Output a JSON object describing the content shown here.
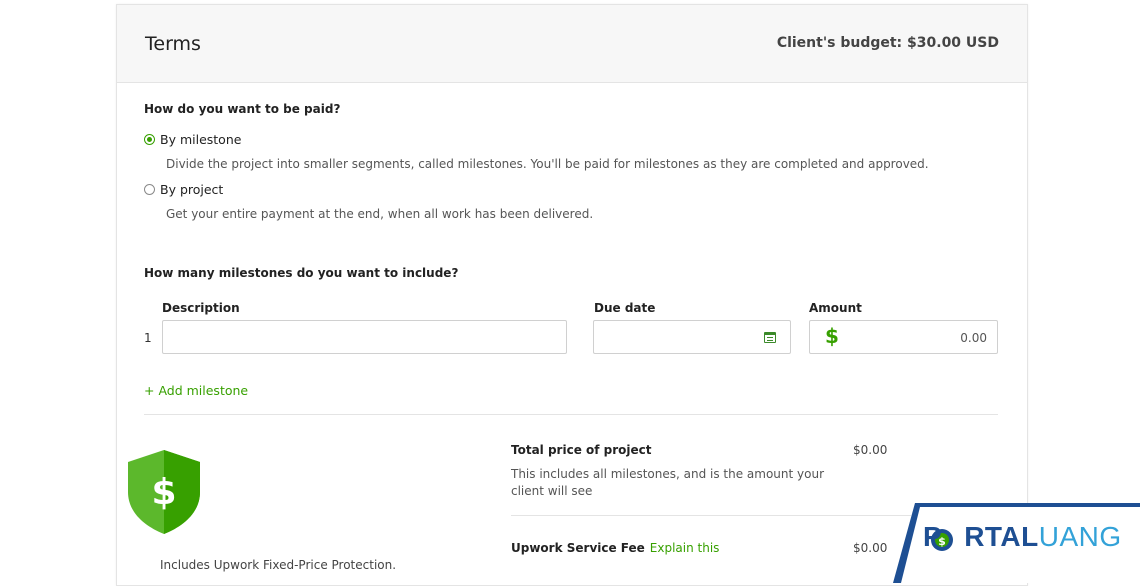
{
  "header": {
    "title": "Terms",
    "budget": "Client's budget: $30.00 USD"
  },
  "payment": {
    "question": "How do you want to be paid?",
    "options": [
      {
        "label": "By milestone",
        "description": "Divide the project into smaller segments, called milestones. You'll be paid for milestones as they are completed and approved.",
        "selected": true
      },
      {
        "label": "By project",
        "description": "Get your entire payment at the end, when all work has been delivered.",
        "selected": false
      }
    ]
  },
  "milestones": {
    "question": "How many milestones do you want to include?",
    "columns": {
      "description": "Description",
      "due_date": "Due date",
      "amount": "Amount"
    },
    "rows": [
      {
        "index": "1",
        "description": "",
        "due_date": "",
        "currency": "$",
        "amount": "0.00"
      }
    ],
    "add_label": "+ Add milestone"
  },
  "summary": {
    "protection_text": "Includes Upwork Fixed-Price Protection.",
    "total_title": "Total price of project",
    "total_value": "$0.00",
    "total_desc": "This includes all milestones, and is the amount your client will see",
    "fee_title": "Upwork Service Fee",
    "fee_link": "Explain this",
    "fee_value": "$0.00"
  },
  "watermark": {
    "brand_part1": "P",
    "brand_part2": "RTAL",
    "brand_part3": "UANG"
  },
  "colors": {
    "accent_green": "#37a000",
    "shield_green": "#5cb82c",
    "watermark_blue": "#1e4f93",
    "watermark_light_blue": "#33a2d8"
  },
  "icons": [
    "radio-selected-icon",
    "radio-unselected-icon",
    "calendar-icon",
    "dollar-icon",
    "shield-dollar-icon",
    "portaluang-logo"
  ]
}
